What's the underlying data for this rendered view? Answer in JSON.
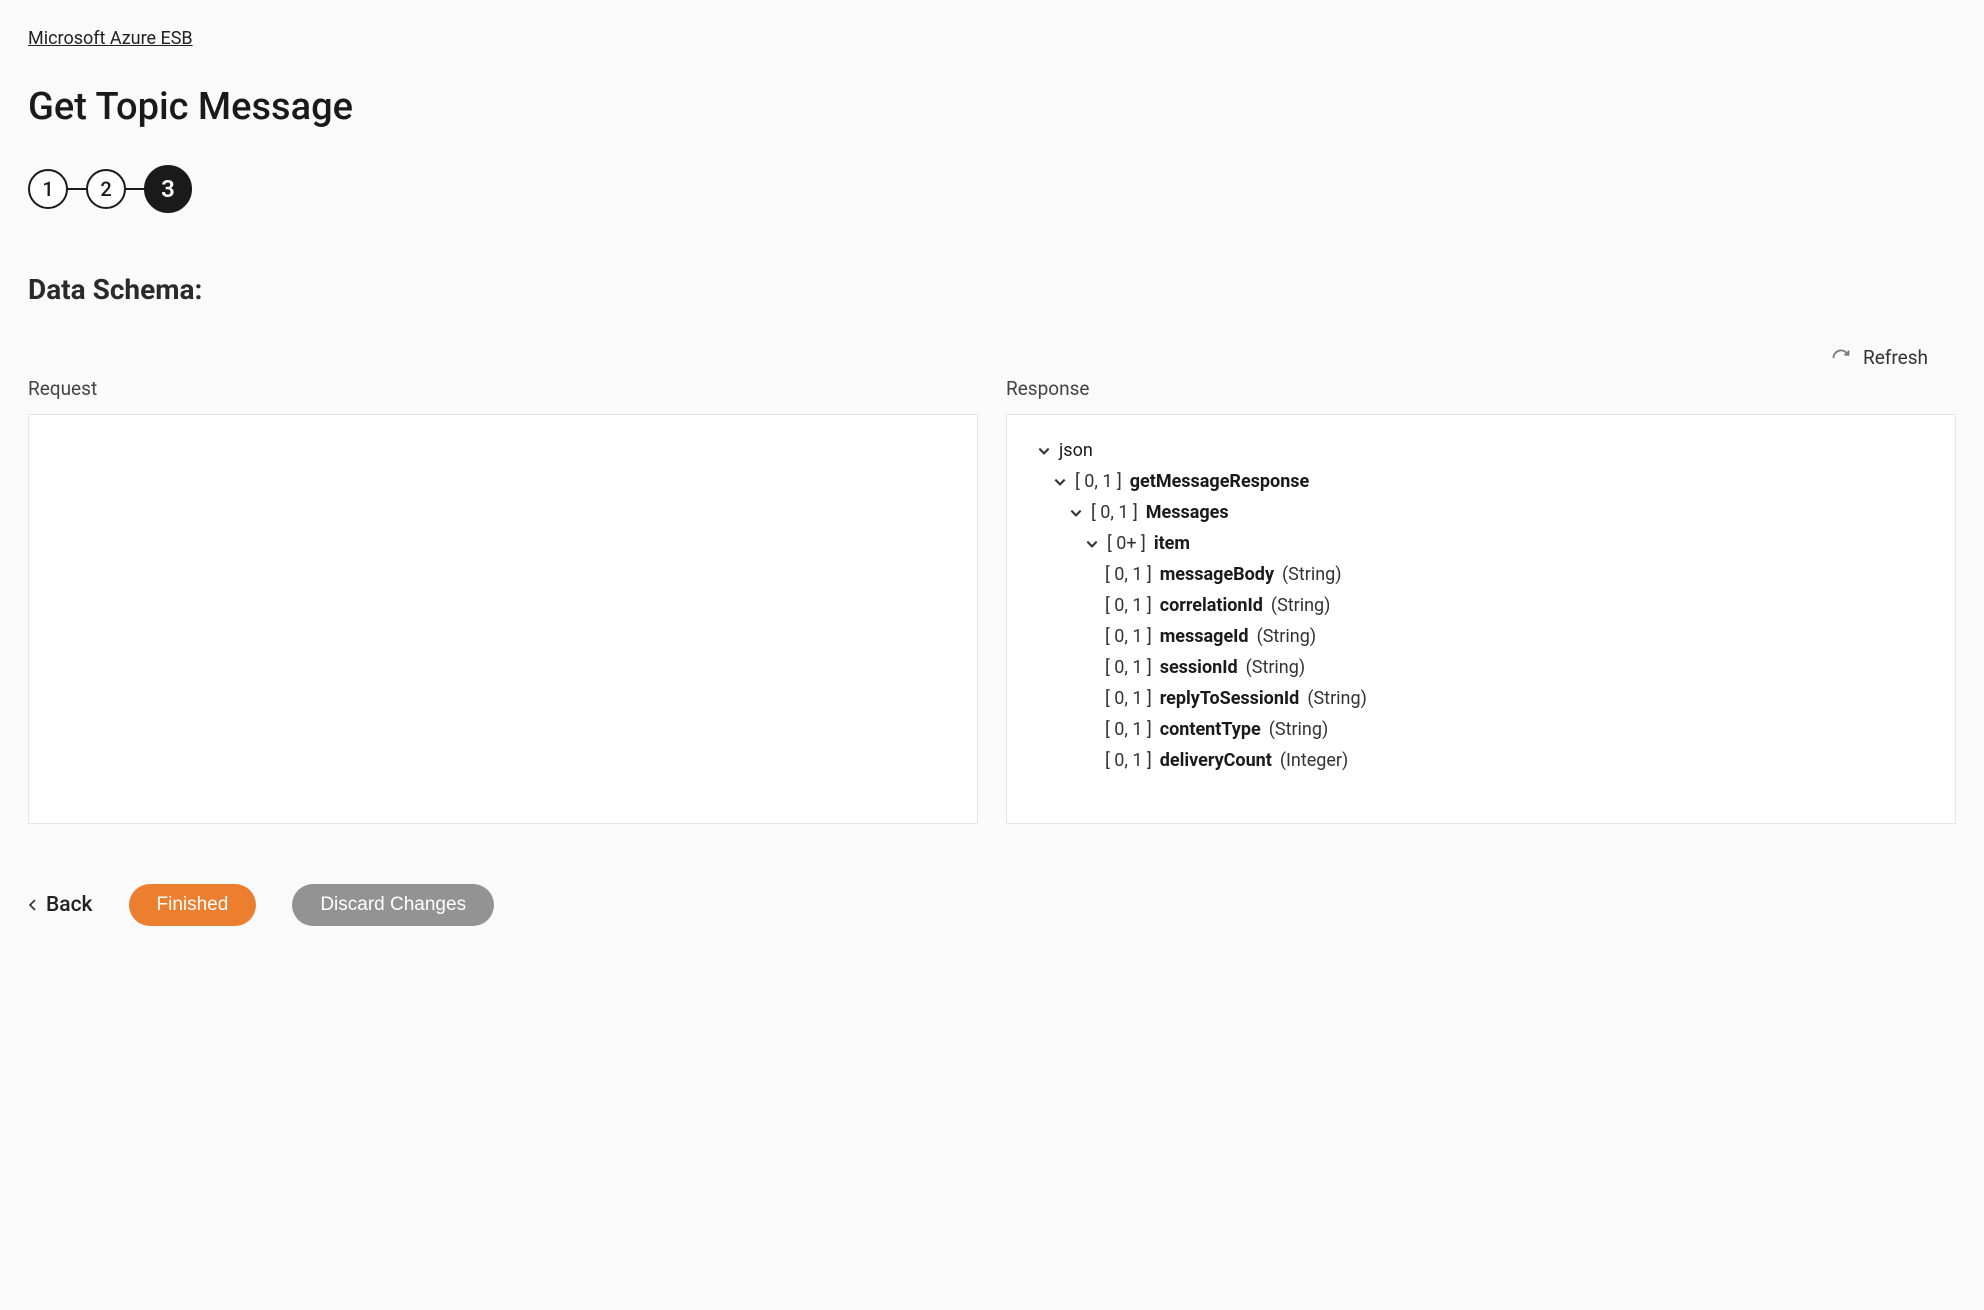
{
  "breadcrumb": "Microsoft Azure ESB",
  "pageTitle": "Get Topic Message",
  "stepper": {
    "steps": [
      "1",
      "2",
      "3"
    ],
    "activeIndex": 2
  },
  "sectionHeading": "Data Schema:",
  "refreshLabel": "Refresh",
  "request": {
    "label": "Request"
  },
  "response": {
    "label": "Response",
    "tree": {
      "root": "json",
      "l1": {
        "card": "[ 0, 1 ]",
        "name": "getMessageResponse"
      },
      "l2": {
        "card": "[ 0, 1 ]",
        "name": "Messages"
      },
      "l3": {
        "card": "[ 0+ ]",
        "name": "item"
      },
      "fields": [
        {
          "card": "[ 0, 1 ]",
          "name": "messageBody",
          "type": "(String)"
        },
        {
          "card": "[ 0, 1 ]",
          "name": "correlationId",
          "type": "(String)"
        },
        {
          "card": "[ 0, 1 ]",
          "name": "messageId",
          "type": "(String)"
        },
        {
          "card": "[ 0, 1 ]",
          "name": "sessionId",
          "type": "(String)"
        },
        {
          "card": "[ 0, 1 ]",
          "name": "replyToSessionId",
          "type": "(String)"
        },
        {
          "card": "[ 0, 1 ]",
          "name": "contentType",
          "type": "(String)"
        },
        {
          "card": "[ 0, 1 ]",
          "name": "deliveryCount",
          "type": "(Integer)"
        }
      ]
    }
  },
  "footer": {
    "back": "Back",
    "finished": "Finished",
    "discard": "Discard Changes"
  }
}
